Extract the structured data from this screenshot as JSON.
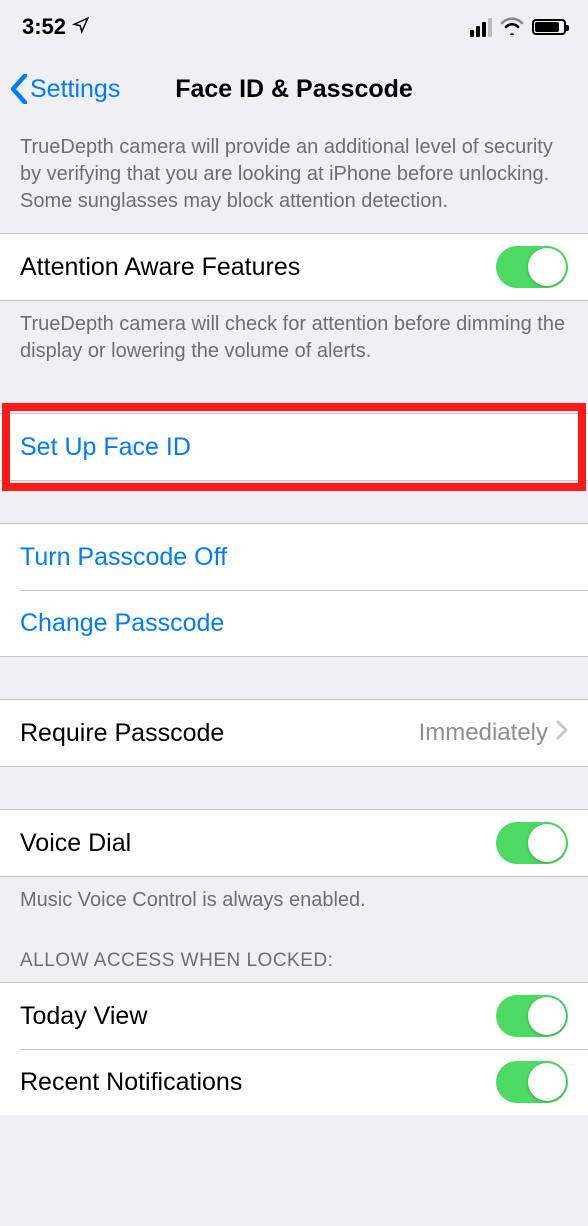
{
  "statusbar": {
    "time": "3:52"
  },
  "nav": {
    "back": "Settings",
    "title": "Face ID & Passcode"
  },
  "truedepth_footer": "TrueDepth camera will provide an additional level of security by verifying that you are looking at iPhone before unlocking. Some sunglasses may block attention detection.",
  "rows": {
    "attention_aware": "Attention Aware Features",
    "attention_footer": "TrueDepth camera will check for attention before dimming the display or lowering the volume of alerts.",
    "setup_faceid": "Set Up Face ID",
    "turn_passcode_off": "Turn Passcode Off",
    "change_passcode": "Change Passcode",
    "require_passcode": "Require Passcode",
    "require_passcode_value": "Immediately",
    "voice_dial": "Voice Dial",
    "voice_dial_footer": "Music Voice Control is always enabled.",
    "allow_header": "ALLOW ACCESS WHEN LOCKED:",
    "today_view": "Today View",
    "recent_notifications": "Recent Notifications"
  }
}
